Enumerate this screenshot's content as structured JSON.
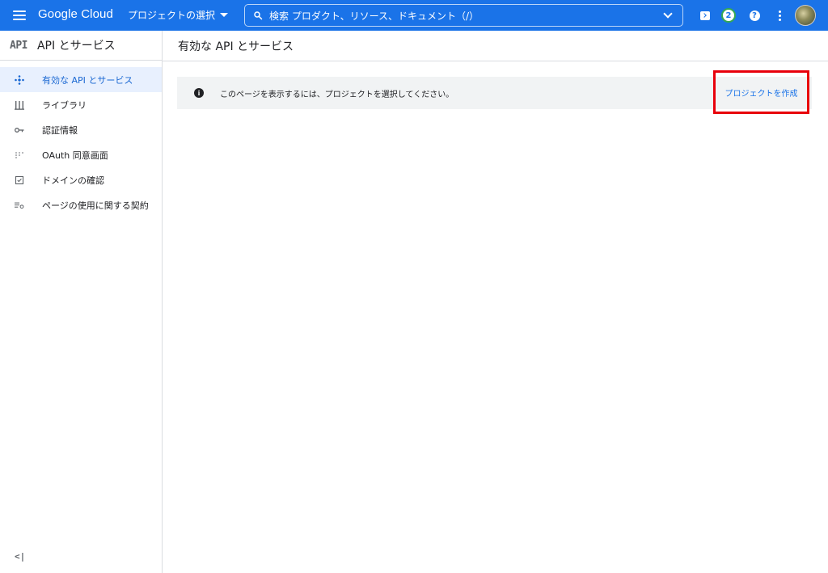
{
  "header": {
    "logo_text": "Google Cloud",
    "project_picker_label": "プロジェクトの選択",
    "search_placeholder": "検索 プロダクト、リソース、ドキュメント（/）",
    "notification_count": "2"
  },
  "sidebar": {
    "logo_text": "API",
    "title": "API とサービス",
    "items": [
      {
        "label": "有効な API とサービス",
        "icon": "api-diamond-icon",
        "active": true
      },
      {
        "label": "ライブラリ",
        "icon": "library-icon"
      },
      {
        "label": "認証情報",
        "icon": "key-icon"
      },
      {
        "label": "OAuth 同意画面",
        "icon": "oauth-consent-icon"
      },
      {
        "label": "ドメインの確認",
        "icon": "domain-check-icon"
      },
      {
        "label": "ページの使用に関する契約",
        "icon": "page-settings-icon"
      }
    ],
    "collapse_label": "<|"
  },
  "main": {
    "page_title": "有効な API とサービス",
    "banner": {
      "message": "このページを表示するには、プロジェクトを選択してください。",
      "action_label": "プロジェクトを作成"
    }
  },
  "colors": {
    "topbar": "#1a73e8",
    "accent": "#1967d2",
    "highlight_box": "#e8000b",
    "banner_bg": "#f1f3f4"
  }
}
